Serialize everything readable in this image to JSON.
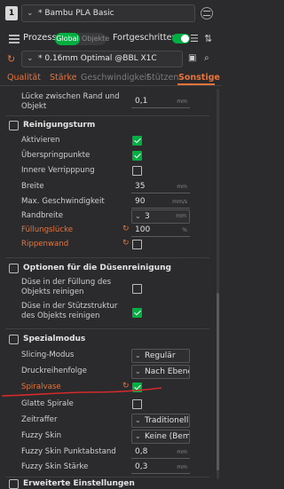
{
  "filament": {
    "index": "1",
    "name": "* Bambu PLA Basic"
  },
  "process": {
    "title": "Prozess",
    "scope_global": "Global",
    "scope_object": "Objekte",
    "advanced_label": "Fortgeschritten"
  },
  "preset": {
    "name": "* 0.16mm Optimal @BBL X1C"
  },
  "tabs": [
    "Qualität",
    "Stärke",
    "Geschwindigkeit",
    "Stützen",
    "Sonstige"
  ],
  "rows": {
    "brim_gap": {
      "label": "Lücke zwischen Rand und Objekt",
      "value": "0,1",
      "unit": "mm"
    },
    "purge_enable": {
      "label": "Aktivieren"
    },
    "skip_points": {
      "label": "Überspringpunkte"
    },
    "inner_wall": {
      "label": "Innere Verripppung"
    },
    "width": {
      "label": "Breite",
      "value": "35",
      "unit": "mm"
    },
    "max_speed": {
      "label": "Max. Geschwindigkeit",
      "value": "90",
      "unit": "mm/s"
    },
    "brim_width": {
      "label": "Randbreite",
      "value": "3",
      "unit": "mm"
    },
    "infill_gap": {
      "label": "Füllungslücke",
      "value": "100",
      "unit": "%"
    },
    "rib_wall": {
      "label": "Rippenwand"
    },
    "purge_infill": {
      "label": "Düse in der Füllung des Objekts reinigen"
    },
    "purge_support": {
      "label": "Düse in der Stützstruktur des Objekts reinigen"
    },
    "slicing_mode": {
      "label": "Slicing-Modus",
      "value": "Regulär"
    },
    "print_sequence": {
      "label": "Druckreihenfolge",
      "value": "Nach Ebene"
    },
    "spiral_vase": {
      "label": "Spiralvase"
    },
    "smooth_spiral": {
      "label": "Glatte Spirale"
    },
    "timelapse": {
      "label": "Zeitraffer",
      "value": "Traditionell"
    },
    "fuzzy_skin": {
      "label": "Fuzzy Skin",
      "value": "Keine (Bem..."
    },
    "fuzzy_point": {
      "label": "Fuzzy Skin Punktabstand",
      "value": "0,8",
      "unit": "mm"
    },
    "fuzzy_thickness": {
      "label": "Fuzzy Skin Stärke",
      "value": "0,3",
      "unit": "mm"
    }
  },
  "sections": {
    "prime_tower": "Reinigungsturm",
    "flush_options": "Optionen für die Düsenreinigung",
    "special_mode": "Spezialmodus",
    "advanced": "Erweiterte Einstellungen"
  },
  "colors": {
    "accent_green": "#00ae42",
    "accent_orange": "#e8733a",
    "annotation_red": "#d32b2b"
  }
}
